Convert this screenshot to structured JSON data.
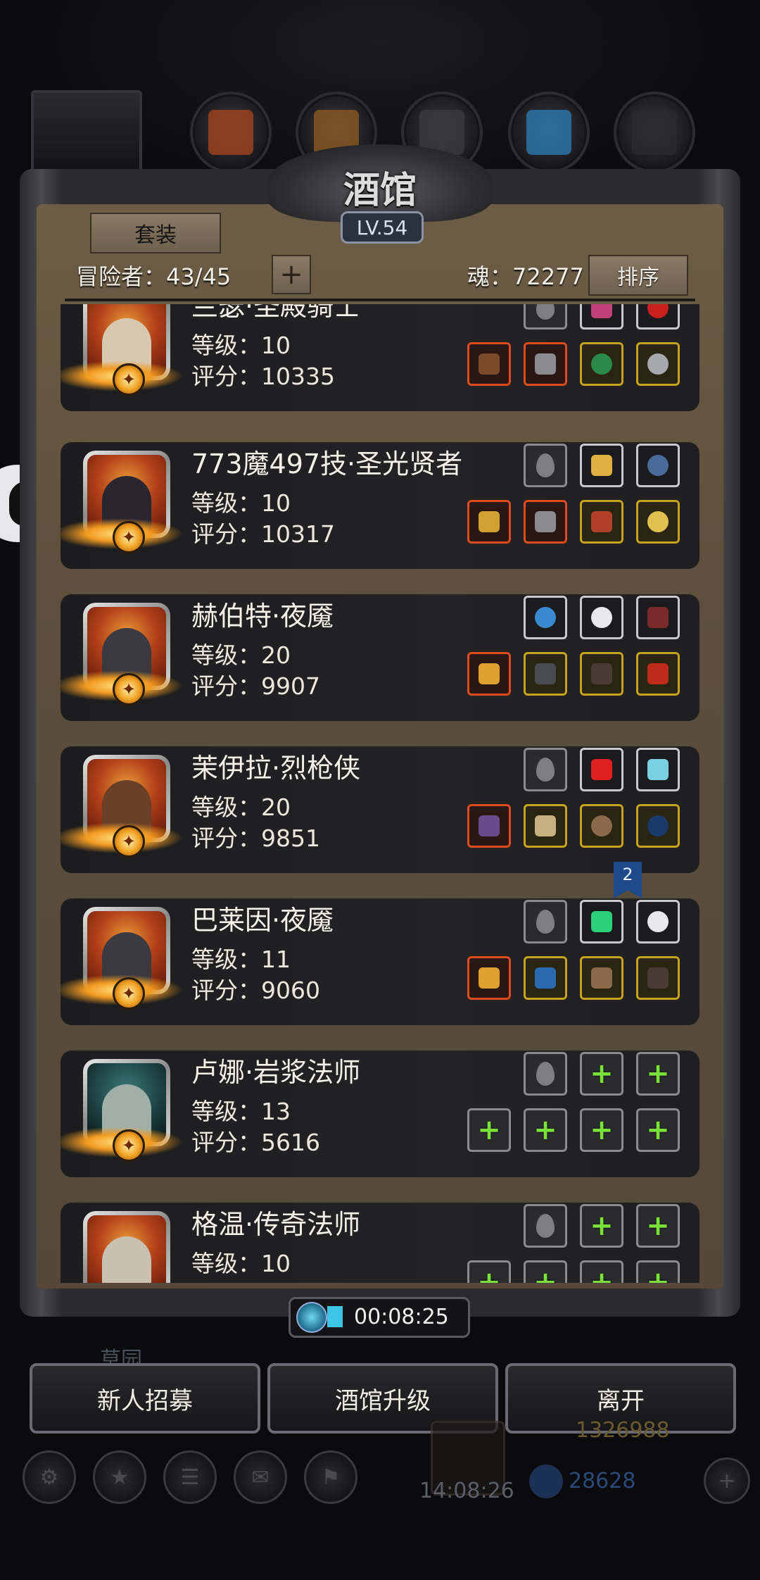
{
  "header": {
    "title": "酒馆",
    "level": "LV.54",
    "set_button": "套装",
    "adventurer_label": "冒险者：43/45",
    "add_button": "+",
    "soul_label": "魂：72277",
    "sort_button": "排序"
  },
  "heroes": [
    {
      "name": "兰瑟·圣殿骑士",
      "level": "等级：10",
      "score": "评分：10335"
    },
    {
      "name": "773魔497技·圣光贤者",
      "level": "等级：10",
      "score": "评分：10317"
    },
    {
      "name": "赫伯特·夜魇",
      "level": "等级：20",
      "score": "评分：9907"
    },
    {
      "name": "茉伊拉·烈枪侠",
      "level": "等级：20",
      "score": "评分：9851"
    },
    {
      "name": "巴莱因·夜魇",
      "level": "等级：11",
      "score": "评分：9060",
      "bookmark": "2"
    },
    {
      "name": "卢娜·岩浆法师",
      "level": "等级：13",
      "score": "评分：5616"
    },
    {
      "name": "格温·传奇法师",
      "level": "等级：10",
      "score": ""
    }
  ],
  "timer": "00:08:25",
  "bottom_buttons": {
    "recruit": "新人招募",
    "upgrade": "酒馆升级",
    "leave": "离开"
  },
  "background": {
    "garden_label": "草园",
    "gold": "1326988",
    "gems": "28628",
    "clock": "14:08:26"
  },
  "colors": {
    "rarity_red": "#e04a1c",
    "rarity_gold": "#c7a21c",
    "rarity_white": "#c9c9cc",
    "plus_green": "#7ae03a"
  }
}
